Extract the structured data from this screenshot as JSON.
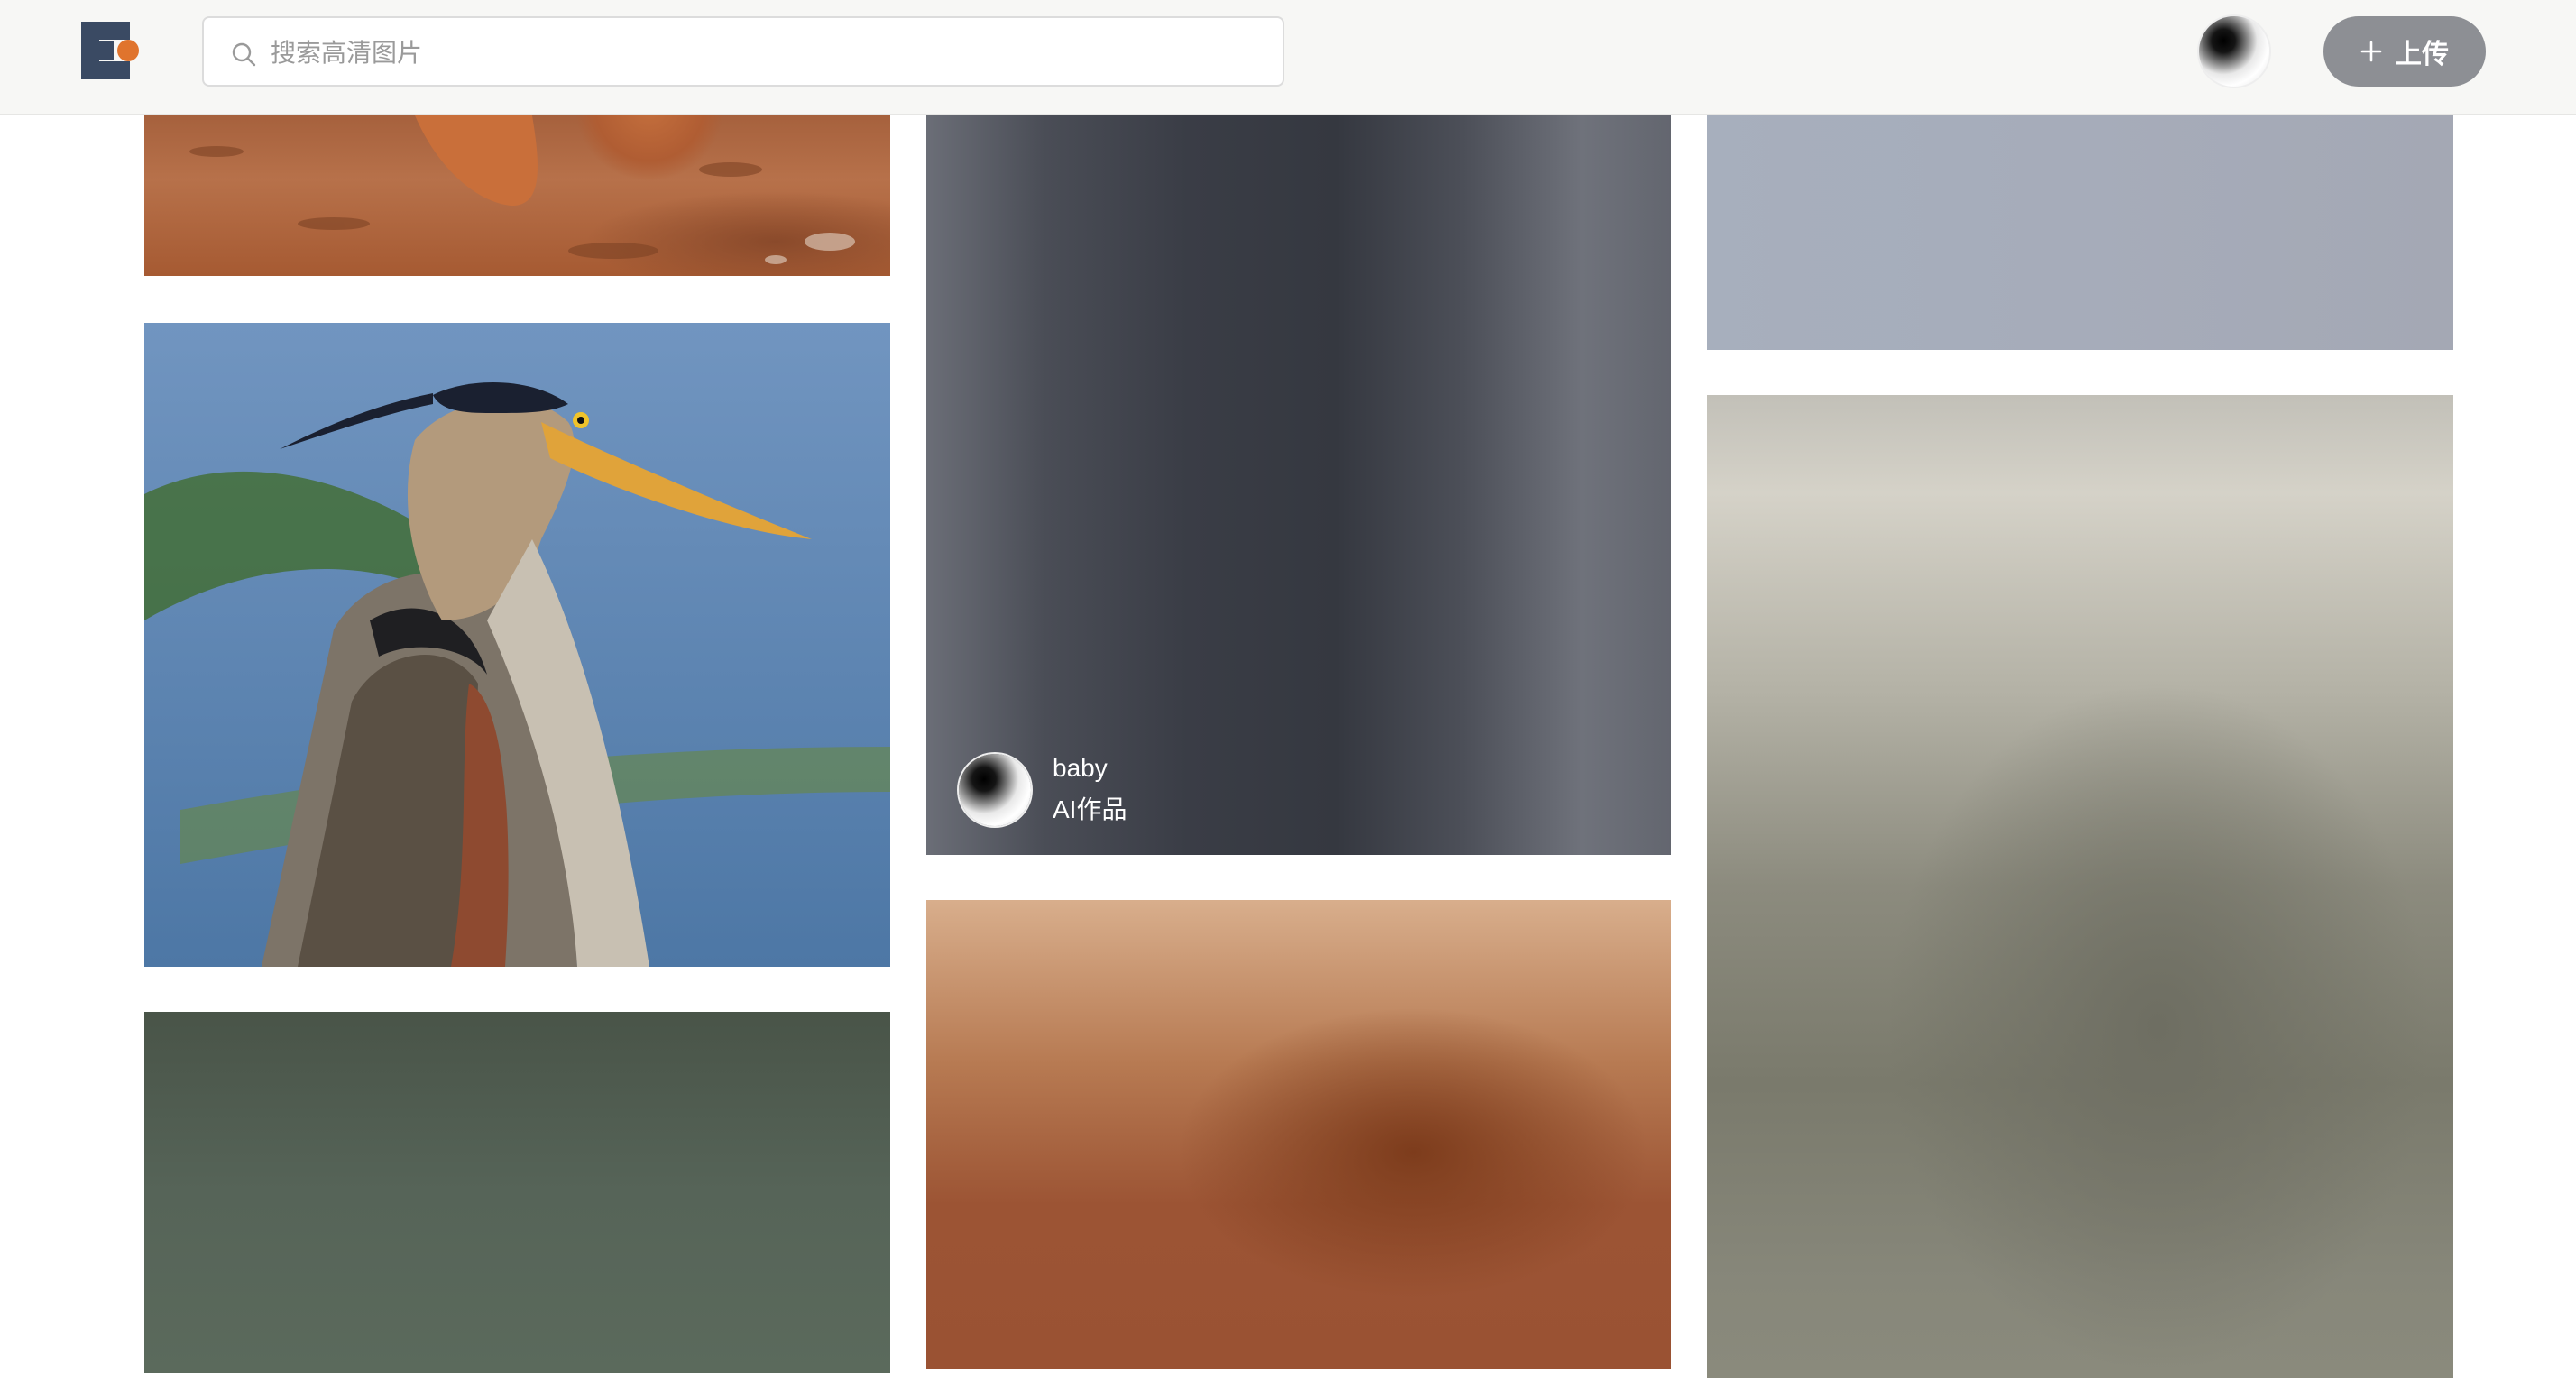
{
  "header": {
    "search": {
      "placeholder": "搜索高清图片"
    },
    "upload_label": "上传"
  },
  "gallery": {
    "featured_author": {
      "name": "baby",
      "subtitle": "AI作品"
    }
  },
  "colors": {
    "topbar_bg": "#f7f7f5",
    "upload_button_bg": "#8d8f94",
    "logo_dark": "#3a4a63",
    "logo_accent": "#e0742d"
  },
  "icons": [
    "logo-icon",
    "search-icon",
    "plus-icon"
  ]
}
